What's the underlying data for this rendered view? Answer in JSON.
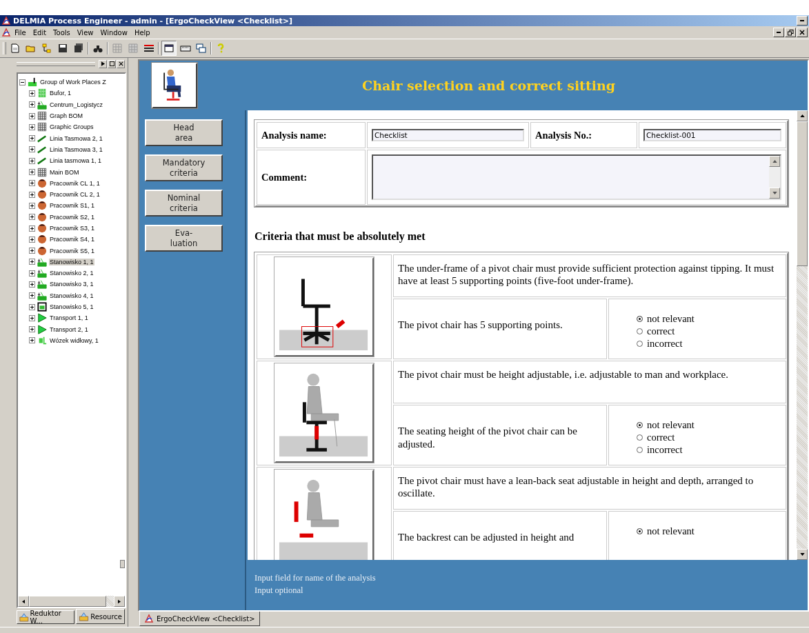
{
  "window": {
    "title": "DELMIA Process Engineer - admin - [ErgoCheckView <Checklist>]"
  },
  "menu": [
    "File",
    "Edit",
    "Tools",
    "View",
    "Window",
    "Help"
  ],
  "tree": {
    "label": "Group of Work Places Z",
    "kind": "group",
    "expanded": true,
    "selected": false,
    "children": [
      {
        "label": "Bufor, 1",
        "kind": "buffer",
        "selected": false
      },
      {
        "label": "Centrum_Logistycz",
        "kind": "station",
        "selected": false
      },
      {
        "label": "Graph BOM",
        "kind": "grid",
        "selected": false
      },
      {
        "label": "Graphic Groups",
        "kind": "grid",
        "selected": false
      },
      {
        "label": "Linia Tasmowa 2, 1",
        "kind": "line",
        "selected": false
      },
      {
        "label": "Linia Tasmowa 3, 1",
        "kind": "line",
        "selected": false
      },
      {
        "label": "Linia tasmowa 1, 1",
        "kind": "line",
        "selected": false
      },
      {
        "label": "Main BOM",
        "kind": "grid",
        "selected": false
      },
      {
        "label": "Pracownik CL 1, 1",
        "kind": "worker",
        "selected": false
      },
      {
        "label": "Pracownik CL 2, 1",
        "kind": "worker",
        "selected": false
      },
      {
        "label": "Pracownik S1, 1",
        "kind": "worker",
        "selected": false
      },
      {
        "label": "Pracownik S2, 1",
        "kind": "worker",
        "selected": false
      },
      {
        "label": "Pracownik S3, 1",
        "kind": "worker",
        "selected": false
      },
      {
        "label": "Pracownik S4, 1",
        "kind": "worker",
        "selected": false
      },
      {
        "label": "Pracownik S5, 1",
        "kind": "worker",
        "selected": false
      },
      {
        "label": "Stanowisko 1, 1",
        "kind": "station",
        "selected": true
      },
      {
        "label": "Stanowisko 2, 1",
        "kind": "station",
        "selected": false
      },
      {
        "label": "Stanowisko 3, 1",
        "kind": "station",
        "selected": false
      },
      {
        "label": "Stanowisko 4, 1",
        "kind": "station",
        "selected": false
      },
      {
        "label": "Stanowisko 5, 1",
        "kind": "machine",
        "selected": false
      },
      {
        "label": "Transport 1, 1",
        "kind": "transport",
        "selected": false
      },
      {
        "label": "Transport 2, 1",
        "kind": "transport",
        "selected": false
      },
      {
        "label": "Wózek widłowy, 1",
        "kind": "forklift",
        "selected": false
      }
    ]
  },
  "panel_tabs": [
    {
      "label": "Reduktor W...",
      "selected": false
    },
    {
      "label": "Resource",
      "selected": true
    }
  ],
  "header": {
    "title": "Chair selection and correct sitting"
  },
  "nav_buttons": [
    "Head\narea",
    "Mandatory\ncriteria",
    "Nominal\ncriteria",
    "Eva-\nluation"
  ],
  "form": {
    "name_label": "Analysis name:",
    "name_value": "Checklist",
    "number_label": "Analysis No.:",
    "number_value": "Checklist-001",
    "comment_label": "Comment:"
  },
  "section_title": "Criteria that must be absolutely met",
  "criteria": [
    {
      "kind": "base",
      "requirement": "The under-frame of a pivot chair must provide sufficient protection against tipping. It must have at least 5 supporting points (five-foot under-frame).",
      "check": "The pivot chair has 5 supporting points.",
      "options": [
        {
          "label": "not relevant",
          "selected": true
        },
        {
          "label": "correct",
          "selected": false
        },
        {
          "label": "incorrect",
          "selected": false
        }
      ]
    },
    {
      "kind": "height",
      "requirement": "The pivot chair must be height adjustable, i.e. adjustable to man and workplace.",
      "check": "The seating height of the pivot chair can be adjusted.",
      "options": [
        {
          "label": "not relevant",
          "selected": true
        },
        {
          "label": "correct",
          "selected": false
        },
        {
          "label": "incorrect",
          "selected": false
        }
      ]
    },
    {
      "kind": "backrest",
      "requirement": "The pivot chair must have a lean-back seat adjustable in height and depth, arranged to oscillate.",
      "check": "The backrest can be adjusted in height and",
      "options": [
        {
          "label": "not relevant",
          "selected": true
        }
      ]
    }
  ],
  "help_lines": [
    "Input field for name of the analysis",
    "Input optional"
  ],
  "doc_tab": {
    "label": "ErgoCheckView <Checklist>"
  }
}
